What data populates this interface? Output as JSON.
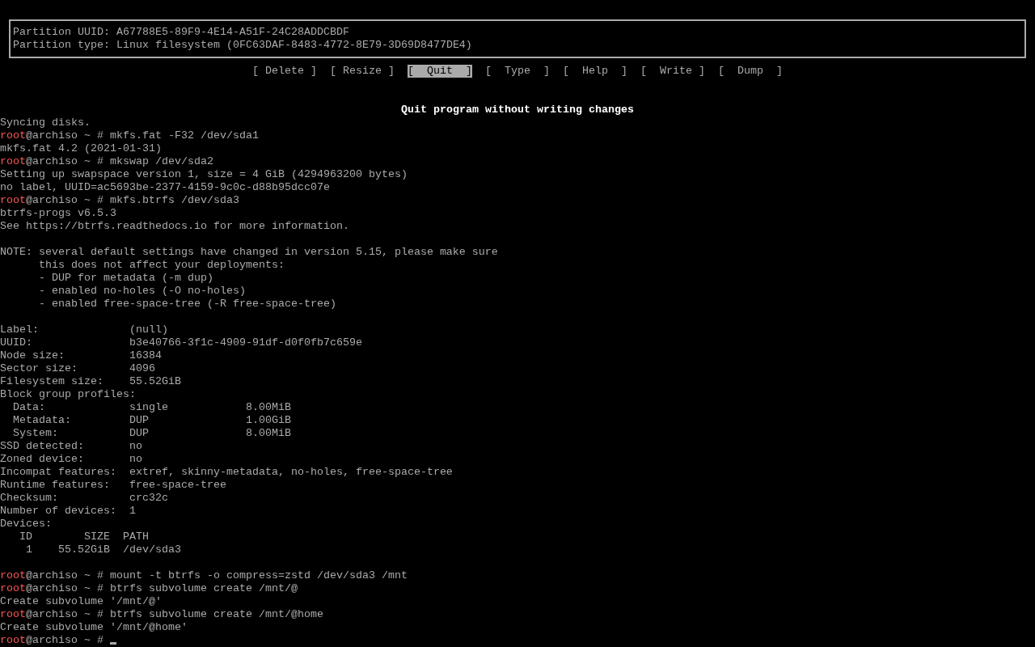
{
  "partition_info": [
    "Partition UUID: A67788E5-89F9-4E14-A51F-24C28ADDCBDF",
    "Partition type: Linux filesystem (0FC63DAF-8483-4772-8E79-3D69D8477DE4)"
  ],
  "menu": [
    {
      "label": "[ Delete ]",
      "selected": false
    },
    {
      "label": "[ Resize ]",
      "selected": false
    },
    {
      "label": "[  Quit  ]",
      "selected": true
    },
    {
      "label": "[  Type  ]",
      "selected": false
    },
    {
      "label": "[  Help  ]",
      "selected": false
    },
    {
      "label": "[  Write ]",
      "selected": false
    },
    {
      "label": "[  Dump  ]",
      "selected": false
    }
  ],
  "hint": "Quit program without writing changes",
  "lines": [
    {
      "kind": "output",
      "text": "Syncing disks."
    },
    {
      "kind": "prompt",
      "user": "root",
      "host": "@archiso ~ # ",
      "command": "mkfs.fat -F32 /dev/sda1",
      "cursor": false
    },
    {
      "kind": "output",
      "text": "mkfs.fat 4.2 (2021-01-31)"
    },
    {
      "kind": "prompt",
      "user": "root",
      "host": "@archiso ~ # ",
      "command": "mkswap /dev/sda2",
      "cursor": false
    },
    {
      "kind": "output",
      "text": "Setting up swapspace version 1, size = 4 GiB (4294963200 bytes)"
    },
    {
      "kind": "output",
      "text": "no label, UUID=ac5693be-2377-4159-9c0c-d88b95dcc07e"
    },
    {
      "kind": "prompt",
      "user": "root",
      "host": "@archiso ~ # ",
      "command": "mkfs.btrfs /dev/sda3",
      "cursor": false
    },
    {
      "kind": "output",
      "text": "btrfs-progs v6.5.3"
    },
    {
      "kind": "output",
      "text": "See https://btrfs.readthedocs.io for more information."
    },
    {
      "kind": "blank"
    },
    {
      "kind": "output",
      "text": "NOTE: several default settings have changed in version 5.15, please make sure"
    },
    {
      "kind": "output",
      "text": "      this does not affect your deployments:"
    },
    {
      "kind": "output",
      "text": "      - DUP for metadata (-m dup)"
    },
    {
      "kind": "output",
      "text": "      - enabled no-holes (-O no-holes)"
    },
    {
      "kind": "output",
      "text": "      - enabled free-space-tree (-R free-space-tree)"
    },
    {
      "kind": "blank"
    },
    {
      "kind": "output",
      "text": "Label:              (null)"
    },
    {
      "kind": "output",
      "text": "UUID:               b3e40766-3f1c-4909-91df-d0f0fb7c659e"
    },
    {
      "kind": "output",
      "text": "Node size:          16384"
    },
    {
      "kind": "output",
      "text": "Sector size:        4096"
    },
    {
      "kind": "output",
      "text": "Filesystem size:    55.52GiB"
    },
    {
      "kind": "output",
      "text": "Block group profiles:"
    },
    {
      "kind": "output",
      "text": "  Data:             single            8.00MiB"
    },
    {
      "kind": "output",
      "text": "  Metadata:         DUP               1.00GiB"
    },
    {
      "kind": "output",
      "text": "  System:           DUP               8.00MiB"
    },
    {
      "kind": "output",
      "text": "SSD detected:       no"
    },
    {
      "kind": "output",
      "text": "Zoned device:       no"
    },
    {
      "kind": "output",
      "text": "Incompat features:  extref, skinny-metadata, no-holes, free-space-tree"
    },
    {
      "kind": "output",
      "text": "Runtime features:   free-space-tree"
    },
    {
      "kind": "output",
      "text": "Checksum:           crc32c"
    },
    {
      "kind": "output",
      "text": "Number of devices:  1"
    },
    {
      "kind": "output",
      "text": "Devices:"
    },
    {
      "kind": "output",
      "text": "   ID        SIZE  PATH"
    },
    {
      "kind": "output",
      "text": "    1    55.52GiB  /dev/sda3"
    },
    {
      "kind": "blank"
    },
    {
      "kind": "prompt",
      "user": "root",
      "host": "@archiso ~ # ",
      "command": "mount -t btrfs -o compress=zstd /dev/sda3 /mnt",
      "cursor": false
    },
    {
      "kind": "prompt",
      "user": "root",
      "host": "@archiso ~ # ",
      "command": "btrfs subvolume create /mnt/@",
      "cursor": false
    },
    {
      "kind": "output",
      "text": "Create subvolume '/mnt/@'"
    },
    {
      "kind": "prompt",
      "user": "root",
      "host": "@archiso ~ # ",
      "command": "btrfs subvolume create /mnt/@home",
      "cursor": false
    },
    {
      "kind": "output",
      "text": "Create subvolume '/mnt/@home'"
    },
    {
      "kind": "prompt",
      "user": "root",
      "host": "@archiso ~ # ",
      "cursor": true
    }
  ]
}
